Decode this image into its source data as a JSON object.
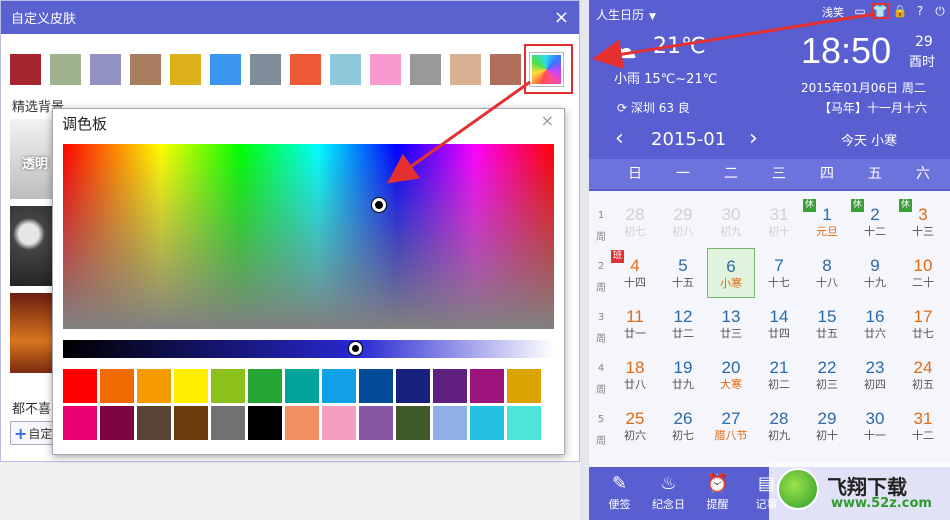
{
  "skin_dialog": {
    "title": "自定义皮肤",
    "close_glyph": "×",
    "swatches": [
      "#a5262e",
      "#9eb38e",
      "#9191c2",
      "#a87e5f",
      "#dcb018",
      "#3b96f2",
      "#7f8c99",
      "#ee5a36",
      "#8fcadb",
      "#f89ad0",
      "#999999",
      "#d8b292",
      "#b06f5d"
    ],
    "featured_label": "精选背景",
    "thumb_label": "透明",
    "dislike_text": "都不喜",
    "custom_button_label": "自定"
  },
  "palette": {
    "title": "调色板",
    "close_glyph": "×",
    "presets": [
      "#ff0000",
      "#ef6a00",
      "#f59a00",
      "#ffee00",
      "#8cc11c",
      "#25a534",
      "#00a49a",
      "#0fa0e6",
      "#004a98",
      "#17207c",
      "#5f1f7f",
      "#9b157d",
      "#dba300",
      "#e90073",
      "#7c0541",
      "#5a4337",
      "#6b3b0c",
      "#717171",
      "#000000",
      "#f39063",
      "#f3a0c0",
      "#8757a4",
      "#3f5828",
      "#8eb0e6",
      "#24c2e0",
      "#4ee4dc"
    ]
  },
  "calendar": {
    "app_name": "人生日历",
    "user_name": "浅笑",
    "temperature": "21℃",
    "weather_desc": "小雨 15℃~21℃",
    "city_aqi": "深圳 63 良",
    "time": "18:50",
    "day_number": "29",
    "weekday_small": "酉时",
    "full_date": "2015年01月06日 周二",
    "lunar_date": "【马年】十一月十六",
    "month_label": "2015-01",
    "today_button": "今天 小寒",
    "weekdays": [
      "日",
      "一",
      "二",
      "三",
      "四",
      "五",
      "六"
    ],
    "week_suffix": "周",
    "weeks": [
      {
        "num": "1",
        "days": [
          {
            "d": "28",
            "s": "初七",
            "other": true
          },
          {
            "d": "29",
            "s": "初八",
            "other": true
          },
          {
            "d": "30",
            "s": "初九",
            "other": true
          },
          {
            "d": "31",
            "s": "初十",
            "other": true
          },
          {
            "d": "1",
            "s": "元旦",
            "color": "blue",
            "sub": "orange",
            "badge": "休",
            "badgeType": "rest"
          },
          {
            "d": "2",
            "s": "十二",
            "color": "blue",
            "badge": "休",
            "badgeType": "rest"
          },
          {
            "d": "3",
            "s": "十三",
            "color": "orange",
            "badge": "休",
            "badgeType": "rest"
          }
        ]
      },
      {
        "num": "2",
        "days": [
          {
            "d": "4",
            "s": "十四",
            "color": "orange",
            "badge": "班",
            "badgeType": "work"
          },
          {
            "d": "5",
            "s": "十五",
            "color": "blue"
          },
          {
            "d": "6",
            "s": "小寒",
            "color": "blue",
            "sub": "orange",
            "today": true
          },
          {
            "d": "7",
            "s": "十七",
            "color": "blue"
          },
          {
            "d": "8",
            "s": "十八",
            "color": "blue"
          },
          {
            "d": "9",
            "s": "十九",
            "color": "blue"
          },
          {
            "d": "10",
            "s": "二十",
            "color": "orange"
          }
        ]
      },
      {
        "num": "3",
        "days": [
          {
            "d": "11",
            "s": "廿一",
            "color": "orange"
          },
          {
            "d": "12",
            "s": "廿二",
            "color": "blue"
          },
          {
            "d": "13",
            "s": "廿三",
            "color": "blue"
          },
          {
            "d": "14",
            "s": "廿四",
            "color": "blue"
          },
          {
            "d": "15",
            "s": "廿五",
            "color": "blue"
          },
          {
            "d": "16",
            "s": "廿六",
            "color": "blue"
          },
          {
            "d": "17",
            "s": "廿七",
            "color": "orange"
          }
        ]
      },
      {
        "num": "4",
        "days": [
          {
            "d": "18",
            "s": "廿八",
            "color": "orange"
          },
          {
            "d": "19",
            "s": "廿九",
            "color": "blue"
          },
          {
            "d": "20",
            "s": "大寒",
            "color": "blue",
            "sub": "orange"
          },
          {
            "d": "21",
            "s": "初二",
            "color": "blue"
          },
          {
            "d": "22",
            "s": "初三",
            "color": "blue"
          },
          {
            "d": "23",
            "s": "初四",
            "color": "blue"
          },
          {
            "d": "24",
            "s": "初五",
            "color": "orange"
          }
        ]
      },
      {
        "num": "5",
        "days": [
          {
            "d": "25",
            "s": "初六",
            "color": "orange"
          },
          {
            "d": "26",
            "s": "初七",
            "color": "blue"
          },
          {
            "d": "27",
            "s": "腊八节",
            "color": "blue",
            "sub": "orange"
          },
          {
            "d": "28",
            "s": "初九",
            "color": "blue"
          },
          {
            "d": "29",
            "s": "初十",
            "color": "blue"
          },
          {
            "d": "30",
            "s": "十一",
            "color": "blue"
          },
          {
            "d": "31",
            "s": "十二",
            "color": "orange"
          }
        ]
      }
    ],
    "tools": [
      {
        "label": "便签",
        "icon": "✎"
      },
      {
        "label": "纪念日",
        "icon": "♨"
      },
      {
        "label": "提醒",
        "icon": "⏰"
      },
      {
        "label": "记事",
        "icon": "▤"
      }
    ]
  },
  "watermark": {
    "title": "飞翔下载",
    "url": "www.52z.com"
  }
}
